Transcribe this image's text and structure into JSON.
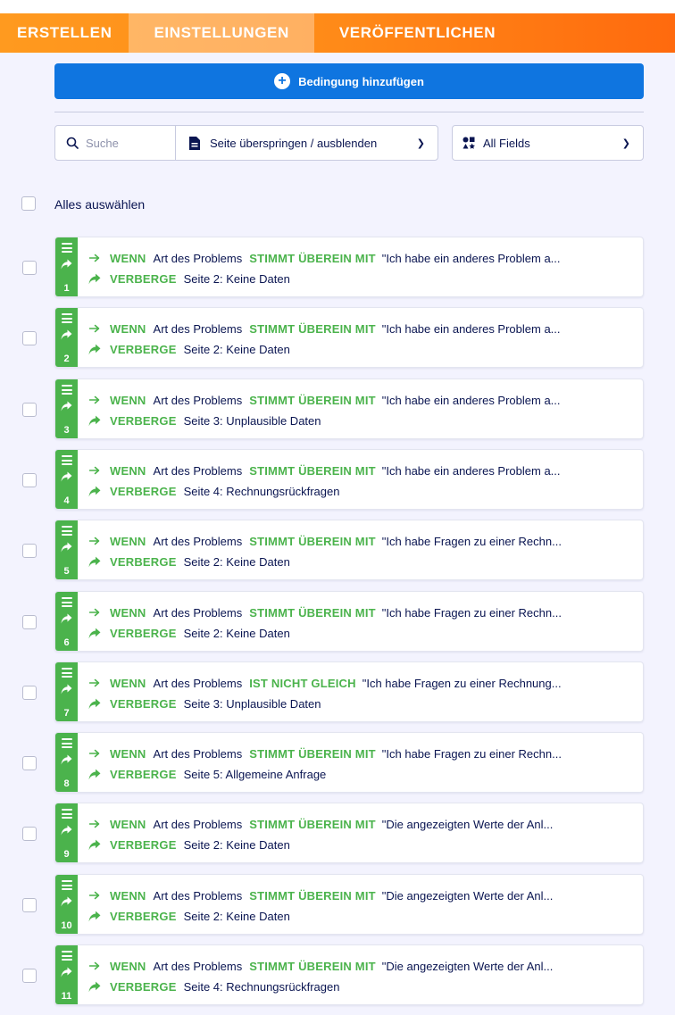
{
  "tabs": [
    {
      "label": "ERSTELLEN",
      "active": false
    },
    {
      "label": "EINSTELLUNGEN",
      "active": true
    },
    {
      "label": "VERÖFFENTLICHEN",
      "active": false
    }
  ],
  "add_condition": {
    "label": "Bedingung hinzufügen"
  },
  "search": {
    "placeholder": "Suche"
  },
  "condition_type_filter": {
    "label": "Seite überspringen / ausblenden"
  },
  "field_filter": {
    "label": "All Fields"
  },
  "select_all": {
    "label": "Alles auswählen"
  },
  "colors": {
    "accent_green": "#4bb34c",
    "primary_blue": "#0f75e0",
    "tab_orange": "#ff8a18"
  },
  "conditions": [
    {
      "number": "1",
      "if_kw": "WENN",
      "field": "Art des Problems",
      "operator": "STIMMT ÜBEREIN MIT",
      "value": "\"Ich habe ein anderes Problem a...",
      "action_kw": "VERBERGE",
      "target": "Seite 2: Keine Daten"
    },
    {
      "number": "2",
      "if_kw": "WENN",
      "field": "Art des Problems",
      "operator": "STIMMT ÜBEREIN MIT",
      "value": "\"Ich habe ein anderes Problem a...",
      "action_kw": "VERBERGE",
      "target": "Seite 2: Keine Daten"
    },
    {
      "number": "3",
      "if_kw": "WENN",
      "field": "Art des Problems",
      "operator": "STIMMT ÜBEREIN MIT",
      "value": "\"Ich habe ein anderes Problem a...",
      "action_kw": "VERBERGE",
      "target": "Seite 3: Unplausible Daten"
    },
    {
      "number": "4",
      "if_kw": "WENN",
      "field": "Art des Problems",
      "operator": "STIMMT ÜBEREIN MIT",
      "value": "\"Ich habe ein anderes Problem a...",
      "action_kw": "VERBERGE",
      "target": "Seite 4: Rechnungsrückfragen"
    },
    {
      "number": "5",
      "if_kw": "WENN",
      "field": "Art des Problems",
      "operator": "STIMMT ÜBEREIN MIT",
      "value": "\"Ich habe Fragen zu einer Rechn...",
      "action_kw": "VERBERGE",
      "target": "Seite 2: Keine Daten"
    },
    {
      "number": "6",
      "if_kw": "WENN",
      "field": "Art des Problems",
      "operator": "STIMMT ÜBEREIN MIT",
      "value": "\"Ich habe Fragen zu einer Rechn...",
      "action_kw": "VERBERGE",
      "target": "Seite 2: Keine Daten"
    },
    {
      "number": "7",
      "if_kw": "WENN",
      "field": "Art des Problems",
      "operator": "IST NICHT GLEICH",
      "value": "\"Ich habe Fragen zu einer Rechnung...",
      "action_kw": "VERBERGE",
      "target": "Seite 3: Unplausible Daten"
    },
    {
      "number": "8",
      "if_kw": "WENN",
      "field": "Art des Problems",
      "operator": "STIMMT ÜBEREIN MIT",
      "value": "\"Ich habe Fragen zu einer Rechn...",
      "action_kw": "VERBERGE",
      "target": "Seite 5: Allgemeine Anfrage"
    },
    {
      "number": "9",
      "if_kw": "WENN",
      "field": "Art des Problems",
      "operator": "STIMMT ÜBEREIN MIT",
      "value": "\"Die angezeigten Werte der Anl...",
      "action_kw": "VERBERGE",
      "target": "Seite 2: Keine Daten"
    },
    {
      "number": "10",
      "if_kw": "WENN",
      "field": "Art des Problems",
      "operator": "STIMMT ÜBEREIN MIT",
      "value": "\"Die angezeigten Werte der Anl...",
      "action_kw": "VERBERGE",
      "target": "Seite 2: Keine Daten"
    },
    {
      "number": "11",
      "if_kw": "WENN",
      "field": "Art des Problems",
      "operator": "STIMMT ÜBEREIN MIT",
      "value": "\"Die angezeigten Werte der Anl...",
      "action_kw": "VERBERGE",
      "target": "Seite 4: Rechnungsrückfragen"
    }
  ]
}
